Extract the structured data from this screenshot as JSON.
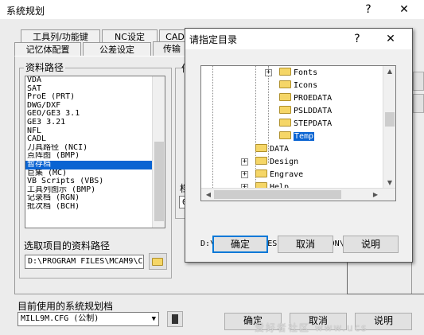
{
  "window": {
    "title": "系统规划",
    "help": "?",
    "close": "✕"
  },
  "tabs_row1": [
    "工具列/功能键",
    "NC设定",
    "CAD"
  ],
  "tabs_row2": [
    "记忆体配置",
    "公差设定",
    "传输"
  ],
  "data_path_group": "资料路径",
  "list_items": [
    "VDA",
    "SAT",
    "ProE (PRT)",
    "DWG/DXF",
    "GEO/GE3 3.1",
    "GE3 3.21",
    "NFL",
    "CADL",
    "刀具路径 (NCI)",
    "点阵图 (BMP)",
    "暂存档",
    "巨集 (MC)",
    "VB Scripts (VBS)",
    "工具列图示 (BMP)",
    "记录档 (RGN)",
    "批次档 (BCH)"
  ],
  "selected_list_index": 10,
  "selected_path_label": "选取项目的资料路径",
  "selected_path_value": "D:\\PROGRAM FILES\\MCAM9\\C",
  "current_config_label": "目前使用的系统规划档",
  "current_config_value": "MILL9M.CFG (公制)",
  "buttons": {
    "ok": "确定",
    "cancel": "取消",
    "help": "说明"
  },
  "partial_side_text": [
    "信",
    "档",
    "0"
  ],
  "dialog": {
    "title": "请指定目录",
    "help": "?",
    "close": "✕",
    "tree": [
      "Fonts",
      "Icons",
      "PROEDATA",
      "PSLDDATA",
      "STEPDATA",
      "Temp",
      "DATA",
      "Design",
      "Engrave",
      "Help"
    ],
    "selected_folder": "Temp",
    "path": "D:\\PROGRAM FILES\\MCAM9\\COMMON\\TEMP",
    "buttons": {
      "ok": "确定",
      "cancel": "取消",
      "help": "说明"
    }
  },
  "watermark": "爱好者社区 www.ucs"
}
